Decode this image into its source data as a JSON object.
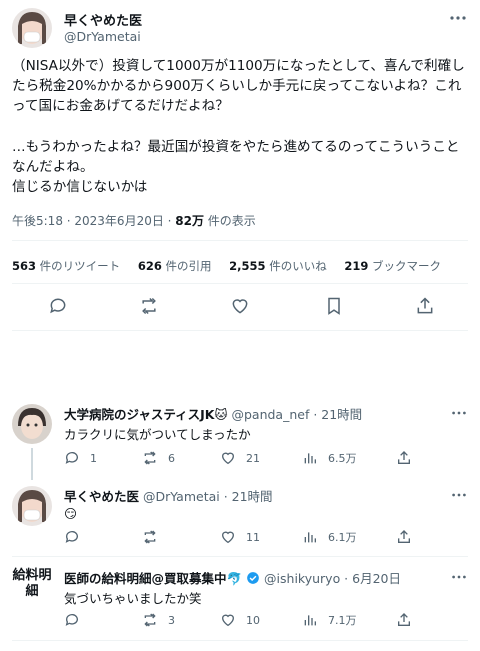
{
  "main_tweet": {
    "author_name": "早くやめた医",
    "author_handle": "@DrYametai",
    "text": "（NISA以外で）投資して1000万が1100万になったとして、喜んで利確したら税金20%かかるから900万くらいしか手元に戻ってこないよね？これって国にお金あげてるだけだよね？\n\n…もうわかったよね？最近国が投資をやたら進めてるのってこういうことなんだよね。\n信じるか信じないかは",
    "timestamp": "午後5:18 · 2023年6月20日 · ",
    "views": "82万",
    "views_suffix": " 件の表示",
    "stats": {
      "retweets": "563",
      "retweets_label": " 件のリツイート",
      "quotes": "626",
      "quotes_label": " 件の引用",
      "likes": "2,555",
      "likes_label": " 件のいいね",
      "bookmarks": "219",
      "bookmarks_label": " ブックマーク"
    },
    "actions": [
      "reply-icon",
      "retweet-icon",
      "like-icon",
      "bookmark-icon",
      "share-icon"
    ]
  },
  "replies": [
    {
      "name": "大学病院のジャスティスJK🐱",
      "handle_time": " @panda_nef · 21時間",
      "text": "カラクリに気がついてしまったか",
      "reply_count": "1",
      "retweet_count": "6",
      "like_count": "21",
      "view_count": "6.5万"
    },
    {
      "name": "早くやめた医",
      "handle_time": " @DrYametai · 21時間",
      "text": "😏",
      "reply_count": "",
      "retweet_count": "",
      "like_count": "11",
      "view_count": "6.1万"
    },
    {
      "avatar_text": "給料明細",
      "name": "医師の給料明細@買取募集中🐬",
      "handle_time": " @ishikyuryo · 6月20日",
      "text": "気づいちゃいましたか笑",
      "reply_count": "",
      "retweet_count": "3",
      "like_count": "10",
      "view_count": "7.1万"
    }
  ],
  "colors": {
    "text": "#0f1419",
    "secondary": "#536471",
    "divider": "#eff3f4",
    "verified": "#1d9bf0"
  }
}
